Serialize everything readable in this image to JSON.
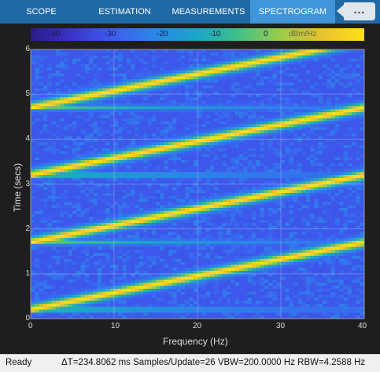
{
  "tabs": [
    {
      "label": "SCOPE"
    },
    {
      "label": "ESTIMATION"
    },
    {
      "label": "MEASUREMENTS"
    },
    {
      "label": "SPECTROGRAM"
    }
  ],
  "overflow_label": "...",
  "colorbar": {
    "ticks": [
      "-40",
      "-30",
      "-20",
      "-10",
      "0"
    ],
    "unit": "dBm/Hz",
    "colors": [
      "#2a1a8a",
      "#3c5ef0",
      "#1aa6c8",
      "#9ccc48",
      "#ffe018"
    ]
  },
  "chart_data": {
    "type": "heatmap",
    "xlabel": "Frequency (Hz)",
    "ylabel": "Time (secs)",
    "xlim": [
      0,
      40
    ],
    "ylim": [
      0,
      6
    ],
    "xticks": [
      "0",
      "10",
      "20",
      "30",
      "40"
    ],
    "yticks": [
      "0",
      "1",
      "2",
      "3",
      "4",
      "5",
      "6"
    ],
    "grid": true,
    "chirp_segments": [
      {
        "t_start": 0.2,
        "t_end": 1.7,
        "f_start": 0,
        "f_end": 40
      },
      {
        "t_start": 1.7,
        "t_end": 3.2,
        "f_start": 0,
        "f_end": 40
      },
      {
        "t_start": 3.2,
        "t_end": 4.7,
        "f_start": 0,
        "f_end": 40
      },
      {
        "t_start": 4.7,
        "t_end": 6.2,
        "f_start": 0,
        "f_end": 40
      }
    ],
    "background_level_dbm": -35,
    "peak_level_dbm": 0
  },
  "status": {
    "ready": "Ready",
    "info": "ΔT=234.8062 ms  Samples/Update=26  VBW=200.0000 Hz  RBW=4.2588 Hz"
  }
}
